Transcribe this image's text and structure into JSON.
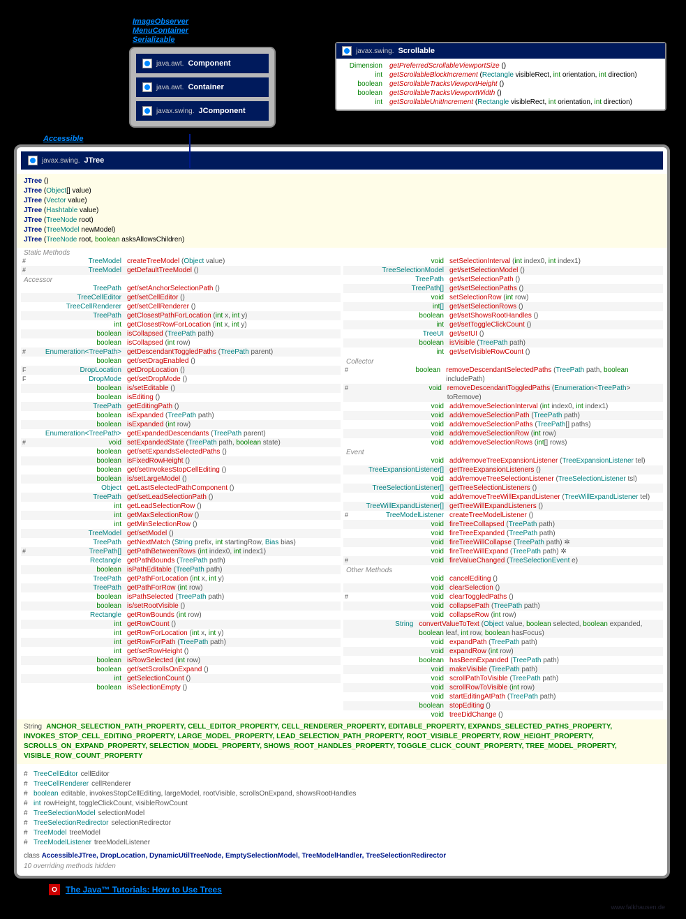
{
  "interfaces": [
    "ImageObserver",
    "MenuContainer",
    "Serializable"
  ],
  "hierarchy": [
    {
      "pkg": "java.awt.",
      "name": "Component"
    },
    {
      "pkg": "java.awt.",
      "name": "Container"
    },
    {
      "pkg": "javax.swing.",
      "name": "JComponent"
    }
  ],
  "scrollable": {
    "pkg": "javax.swing.",
    "name": "Scrollable",
    "methods": [
      {
        "ret": "Dimension",
        "name": "getPreferredScrollableViewportSize",
        "params": "()"
      },
      {
        "ret": "int",
        "name": "getScrollableBlockIncrement",
        "params": "(Rectangle visibleRect, int orientation, int direction)"
      },
      {
        "ret": "boolean",
        "name": "getScrollableTracksViewportHeight",
        "params": "()"
      },
      {
        "ret": "boolean",
        "name": "getScrollableTracksViewportWidth",
        "params": "()"
      },
      {
        "ret": "int",
        "name": "getScrollableUnitIncrement",
        "params": "(Rectangle visibleRect, int orientation, int direction)"
      }
    ]
  },
  "accessible": "Accessible",
  "main": {
    "pkg": "javax.swing.",
    "name": "JTree"
  },
  "constructors": [
    "JTree ()",
    "JTree (Object[] value)",
    "JTree (Vector<?> value)",
    "JTree (Hashtable<?, ?> value)",
    "JTree (TreeNode root)",
    "JTree (TreeModel newModel)",
    "JTree (TreeNode root, boolean asksAllowsChildren)"
  ],
  "properties": "ANCHOR_SELECTION_PATH_PROPERTY, CELL_EDITOR_PROPERTY, CELL_RENDERER_PROPERTY, EDITABLE_PROPERTY, EXPANDS_SELECTED_PATHS_PROPERTY, INVOKES_STOP_CELL_EDITING_PROPERTY, LARGE_MODEL_PROPERTY, LEAD_SELECTION_PATH_PROPERTY, ROOT_VISIBLE_PROPERTY, ROW_HEIGHT_PROPERTY, SCROLLS_ON_EXPAND_PROPERTY, SELECTION_MODEL_PROPERTY, SHOWS_ROOT_HANDLES_PROPERTY, TOGGLE_CLICK_COUNT_PROPERTY, TREE_MODEL_PROPERTY, VISIBLE_ROW_COUNT_PROPERTY",
  "fields": [
    {
      "mod": "#",
      "type": "TreeCellEditor",
      "name": "cellEditor"
    },
    {
      "mod": "#",
      "type": "TreeCellRenderer",
      "name": "cellRenderer"
    },
    {
      "mod": "#",
      "type": "boolean",
      "name": "editable, invokesStopCellEditing, largeModel, rootVisible, scrollsOnExpand, showsRootHandles"
    },
    {
      "mod": "#",
      "type": "int",
      "name": "rowHeight, toggleClickCount, visibleRowCount"
    },
    {
      "mod": "#",
      "type": "TreeSelectionModel",
      "name": "selectionModel"
    },
    {
      "mod": "#",
      "type": "TreeSelectionRedirector",
      "name": "selectionRedirector"
    },
    {
      "mod": "#",
      "type": "TreeModel",
      "name": "treeModel"
    },
    {
      "mod": "#",
      "type": "TreeModelListener",
      "name": "treeModelListener"
    }
  ],
  "class_line": "class AccessibleJTree, DropLocation, DynamicUtilTreeNode, EmptySelectionModel, TreeModelHandler, TreeSelectionRedirector",
  "hidden_note": "10 overriding methods hidden",
  "tutorial": "The Java™ Tutorials: How to Use Trees",
  "footer": "www.falkhausen.de",
  "sections": {
    "static": "Static Methods",
    "accessor": "Accessor",
    "collector": "Collector",
    "event": "Event",
    "other": "Other Methods"
  },
  "left_methods": {
    "static": [
      {
        "mod": "#",
        "ret": "TreeModel",
        "name": "createTreeModel",
        "params": "(Object value)"
      },
      {
        "mod": "#",
        "ret": "TreeModel",
        "name": "getDefaultTreeModel",
        "params": "()"
      }
    ],
    "accessor": [
      {
        "mod": "",
        "ret": "TreePath",
        "name": "get/setAnchorSelectionPath",
        "params": "()"
      },
      {
        "mod": "",
        "ret": "TreeCellEditor",
        "name": "get/setCellEditor",
        "params": "()"
      },
      {
        "mod": "",
        "ret": "TreeCellRenderer",
        "name": "get/setCellRenderer",
        "params": "()"
      },
      {
        "mod": "",
        "ret": "TreePath",
        "name": "getClosestPathForLocation",
        "params": "(int x, int y)"
      },
      {
        "mod": "",
        "ret": "int",
        "name": "getClosestRowForLocation",
        "params": "(int x, int y)"
      },
      {
        "mod": "",
        "ret": "boolean",
        "name": "isCollapsed",
        "params": "(TreePath path)"
      },
      {
        "mod": "",
        "ret": "boolean",
        "name": "isCollapsed",
        "params": "(int row)"
      },
      {
        "mod": "#",
        "ret": "Enumeration<TreePath>",
        "name": "getDescendantToggledPaths",
        "params": "(TreePath parent)"
      },
      {
        "mod": "",
        "ret": "boolean",
        "name": "get/setDragEnabled",
        "params": "()"
      },
      {
        "mod": "F",
        "ret": "DropLocation",
        "name": "getDropLocation",
        "params": "()"
      },
      {
        "mod": "F",
        "ret": "DropMode",
        "name": "get/setDropMode",
        "params": "()"
      },
      {
        "mod": "",
        "ret": "boolean",
        "name": "is/setEditable",
        "params": "()"
      },
      {
        "mod": "",
        "ret": "boolean",
        "name": "isEditing",
        "params": "()"
      },
      {
        "mod": "",
        "ret": "TreePath",
        "name": "getEditingPath",
        "params": "()"
      },
      {
        "mod": "",
        "ret": "boolean",
        "name": "isExpanded",
        "params": "(TreePath path)"
      },
      {
        "mod": "",
        "ret": "boolean",
        "name": "isExpanded",
        "params": "(int row)"
      },
      {
        "mod": "",
        "ret": "Enumeration<TreePath>",
        "name": "getExpandedDescendants",
        "params": "(TreePath parent)"
      },
      {
        "mod": "#",
        "ret": "void",
        "name": "setExpandedState",
        "params": "(TreePath path, boolean state)"
      },
      {
        "mod": "",
        "ret": "boolean",
        "name": "get/setExpandsSelectedPaths",
        "params": "()"
      },
      {
        "mod": "",
        "ret": "boolean",
        "name": "isFixedRowHeight",
        "params": "()"
      },
      {
        "mod": "",
        "ret": "boolean",
        "name": "get/setInvokesStopCellEditing",
        "params": "()"
      },
      {
        "mod": "",
        "ret": "boolean",
        "name": "is/setLargeModel",
        "params": "()"
      },
      {
        "mod": "",
        "ret": "Object",
        "name": "getLastSelectedPathComponent",
        "params": "()"
      },
      {
        "mod": "",
        "ret": "TreePath",
        "name": "get/setLeadSelectionPath",
        "params": "()"
      },
      {
        "mod": "",
        "ret": "int",
        "name": "getLeadSelectionRow",
        "params": "()"
      },
      {
        "mod": "",
        "ret": "int",
        "name": "getMaxSelectionRow",
        "params": "()"
      },
      {
        "mod": "",
        "ret": "int",
        "name": "getMinSelectionRow",
        "params": "()"
      },
      {
        "mod": "",
        "ret": "TreeModel",
        "name": "get/setModel",
        "params": "()"
      },
      {
        "mod": "",
        "ret": "TreePath",
        "name": "getNextMatch",
        "params": "(String prefix, int startingRow, Bias bias)"
      },
      {
        "mod": "#",
        "ret": "TreePath[]",
        "name": "getPathBetweenRows",
        "params": "(int index0, int index1)"
      },
      {
        "mod": "",
        "ret": "Rectangle",
        "name": "getPathBounds",
        "params": "(TreePath path)"
      },
      {
        "mod": "",
        "ret": "boolean",
        "name": "isPathEditable",
        "params": "(TreePath path)"
      },
      {
        "mod": "",
        "ret": "TreePath",
        "name": "getPathForLocation",
        "params": "(int x, int y)"
      },
      {
        "mod": "",
        "ret": "TreePath",
        "name": "getPathForRow",
        "params": "(int row)"
      },
      {
        "mod": "",
        "ret": "boolean",
        "name": "isPathSelected",
        "params": "(TreePath path)"
      },
      {
        "mod": "",
        "ret": "boolean",
        "name": "is/setRootVisible",
        "params": "()"
      },
      {
        "mod": "",
        "ret": "Rectangle",
        "name": "getRowBounds",
        "params": "(int row)"
      },
      {
        "mod": "",
        "ret": "int",
        "name": "getRowCount",
        "params": "()"
      },
      {
        "mod": "",
        "ret": "int",
        "name": "getRowForLocation",
        "params": "(int x, int y)"
      },
      {
        "mod": "",
        "ret": "int",
        "name": "getRowForPath",
        "params": "(TreePath path)"
      },
      {
        "mod": "",
        "ret": "int",
        "name": "get/setRowHeight",
        "params": "()"
      },
      {
        "mod": "",
        "ret": "boolean",
        "name": "isRowSelected",
        "params": "(int row)"
      },
      {
        "mod": "",
        "ret": "boolean",
        "name": "get/setScrollsOnExpand",
        "params": "()"
      },
      {
        "mod": "",
        "ret": "int",
        "name": "getSelectionCount",
        "params": "()"
      },
      {
        "mod": "",
        "ret": "boolean",
        "name": "isSelectionEmpty",
        "params": "()"
      }
    ]
  },
  "right_methods": {
    "accessor": [
      {
        "mod": "",
        "ret": "void",
        "name": "setSelectionInterval",
        "params": "(int index0, int index1)"
      },
      {
        "mod": "",
        "ret": "TreeSelectionModel",
        "name": "get/setSelectionModel",
        "params": "()"
      },
      {
        "mod": "",
        "ret": "TreePath",
        "name": "get/setSelectionPath",
        "params": "()"
      },
      {
        "mod": "",
        "ret": "TreePath[]",
        "name": "get/setSelectionPaths",
        "params": "()"
      },
      {
        "mod": "",
        "ret": "void",
        "name": "setSelectionRow",
        "params": "(int row)"
      },
      {
        "mod": "",
        "ret": "int[]",
        "name": "get/setSelectionRows",
        "params": "()"
      },
      {
        "mod": "",
        "ret": "boolean",
        "name": "get/setShowsRootHandles",
        "params": "()"
      },
      {
        "mod": "",
        "ret": "int",
        "name": "get/setToggleClickCount",
        "params": "()"
      },
      {
        "mod": "",
        "ret": "TreeUI",
        "name": "get/setUI",
        "params": "()"
      },
      {
        "mod": "",
        "ret": "boolean",
        "name": "isVisible",
        "params": "(TreePath path)"
      },
      {
        "mod": "",
        "ret": "int",
        "name": "get/setVisibleRowCount",
        "params": "()"
      }
    ],
    "collector": [
      {
        "mod": "#",
        "ret": "boolean",
        "name": "removeDescendantSelectedPaths",
        "params": "(TreePath path, boolean includePath)"
      },
      {
        "mod": "#",
        "ret": "void",
        "name": "removeDescendantToggledPaths",
        "params": "(Enumeration<TreePath> toRemove)"
      },
      {
        "mod": "",
        "ret": "void",
        "name": "add/removeSelectionInterval",
        "params": "(int index0, int index1)"
      },
      {
        "mod": "",
        "ret": "void",
        "name": "add/removeSelectionPath",
        "params": "(TreePath path)"
      },
      {
        "mod": "",
        "ret": "void",
        "name": "add/removeSelectionPaths",
        "params": "(TreePath[] paths)"
      },
      {
        "mod": "",
        "ret": "void",
        "name": "add/removeSelectionRow",
        "params": "(int row)"
      },
      {
        "mod": "",
        "ret": "void",
        "name": "add/removeSelectionRows",
        "params": "(int[] rows)"
      }
    ],
    "event": [
      {
        "mod": "",
        "ret": "void",
        "name": "add/removeTreeExpansionListener",
        "params": "(TreeExpansionListener tel)"
      },
      {
        "mod": "",
        "ret": "TreeExpansionListener[]",
        "name": "getTreeExpansionListeners",
        "params": "()"
      },
      {
        "mod": "",
        "ret": "void",
        "name": "add/removeTreeSelectionListener",
        "params": "(TreeSelectionListener tsl)"
      },
      {
        "mod": "",
        "ret": "TreeSelectionListener[]",
        "name": "getTreeSelectionListeners",
        "params": "()"
      },
      {
        "mod": "",
        "ret": "void",
        "name": "add/removeTreeWillExpandListener",
        "params": "(TreeWillExpandListener tel)"
      },
      {
        "mod": "",
        "ret": "TreeWillExpandListener[]",
        "name": "getTreeWillExpandListeners",
        "params": "()"
      },
      {
        "mod": "#",
        "ret": "TreeModelListener",
        "name": "createTreeModelListener",
        "params": "()"
      },
      {
        "mod": "",
        "ret": "void",
        "name": "fireTreeCollapsed",
        "params": "(TreePath path)"
      },
      {
        "mod": "",
        "ret": "void",
        "name": "fireTreeExpanded",
        "params": "(TreePath path)"
      },
      {
        "mod": "",
        "ret": "void",
        "name": "fireTreeWillCollapse",
        "params": "(TreePath path) ✲"
      },
      {
        "mod": "",
        "ret": "void",
        "name": "fireTreeWillExpand",
        "params": "(TreePath path) ✲"
      },
      {
        "mod": "#",
        "ret": "void",
        "name": "fireValueChanged",
        "params": "(TreeSelectionEvent e)"
      }
    ],
    "other": [
      {
        "mod": "",
        "ret": "void",
        "name": "cancelEditing",
        "params": "()"
      },
      {
        "mod": "",
        "ret": "void",
        "name": "clearSelection",
        "params": "()"
      },
      {
        "mod": "#",
        "ret": "void",
        "name": "clearToggledPaths",
        "params": "()"
      },
      {
        "mod": "",
        "ret": "void",
        "name": "collapsePath",
        "params": "(TreePath path)"
      },
      {
        "mod": "",
        "ret": "void",
        "name": "collapseRow",
        "params": "(int row)"
      },
      {
        "mod": "",
        "ret": "String",
        "name": "convertValueToText",
        "params": "(Object value, boolean selected, boolean expanded, boolean leaf, int row, boolean hasFocus)"
      },
      {
        "mod": "",
        "ret": "void",
        "name": "expandPath",
        "params": "(TreePath path)"
      },
      {
        "mod": "",
        "ret": "void",
        "name": "expandRow",
        "params": "(int row)"
      },
      {
        "mod": "",
        "ret": "boolean",
        "name": "hasBeenExpanded",
        "params": "(TreePath path)"
      },
      {
        "mod": "",
        "ret": "void",
        "name": "makeVisible",
        "params": "(TreePath path)"
      },
      {
        "mod": "",
        "ret": "void",
        "name": "scrollPathToVisible",
        "params": "(TreePath path)"
      },
      {
        "mod": "",
        "ret": "void",
        "name": "scrollRowToVisible",
        "params": "(int row)"
      },
      {
        "mod": "",
        "ret": "void",
        "name": "startEditingAtPath",
        "params": "(TreePath path)"
      },
      {
        "mod": "",
        "ret": "boolean",
        "name": "stopEditing",
        "params": "()"
      },
      {
        "mod": "",
        "ret": "void",
        "name": "treeDidChange",
        "params": "()"
      }
    ]
  }
}
